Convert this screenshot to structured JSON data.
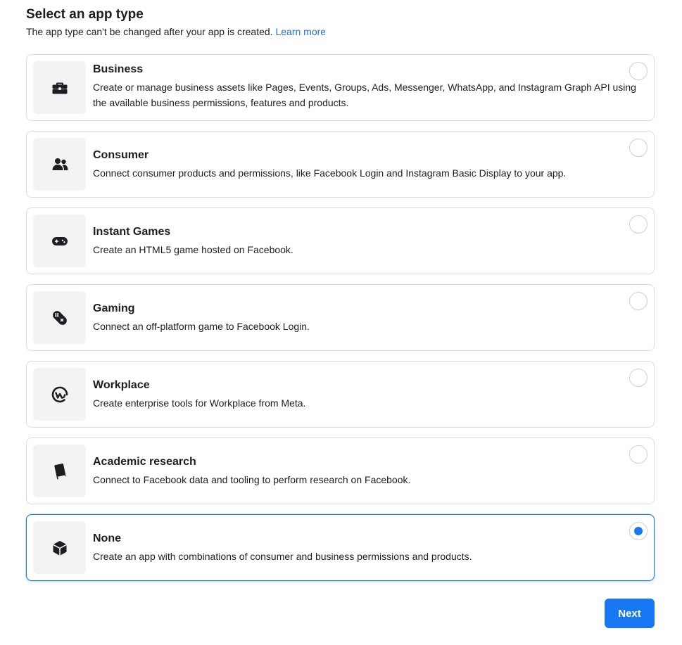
{
  "header": {
    "title": "Select an app type",
    "subtitle": "The app type can't be changed after your app is created.",
    "learn_more": "Learn more"
  },
  "options": [
    {
      "title": "Business",
      "description": "Create or manage business assets like Pages, Events, Groups, Ads, Messenger, WhatsApp, and Instagram Graph API using the available business permissions, features and products.",
      "icon": "briefcase-icon",
      "selected": false
    },
    {
      "title": "Consumer",
      "description": "Connect consumer products and permissions, like Facebook Login and Instagram Basic Display to your app.",
      "icon": "people-icon",
      "selected": false
    },
    {
      "title": "Instant Games",
      "description": "Create an HTML5 game hosted on Facebook.",
      "icon": "game-controller-icon",
      "selected": false
    },
    {
      "title": "Gaming",
      "description": "Connect an off-platform game to Facebook Login.",
      "icon": "gamepad-tilted-icon",
      "selected": false
    },
    {
      "title": "Workplace",
      "description": "Create enterprise tools for Workplace from Meta.",
      "icon": "workplace-logo-icon",
      "selected": false
    },
    {
      "title": "Academic research",
      "description": "Connect to Facebook data and tooling to perform research on Facebook.",
      "icon": "book-icon",
      "selected": false
    },
    {
      "title": "None",
      "description": "Create an app with combinations of consumer and business permissions and products.",
      "icon": "cube-icon",
      "selected": true
    }
  ],
  "footer": {
    "next_label": "Next"
  },
  "colors": {
    "accent": "#1877f2",
    "link": "#216fdb",
    "border": "#dadde1",
    "icon_bg": "#f2f3f5"
  }
}
